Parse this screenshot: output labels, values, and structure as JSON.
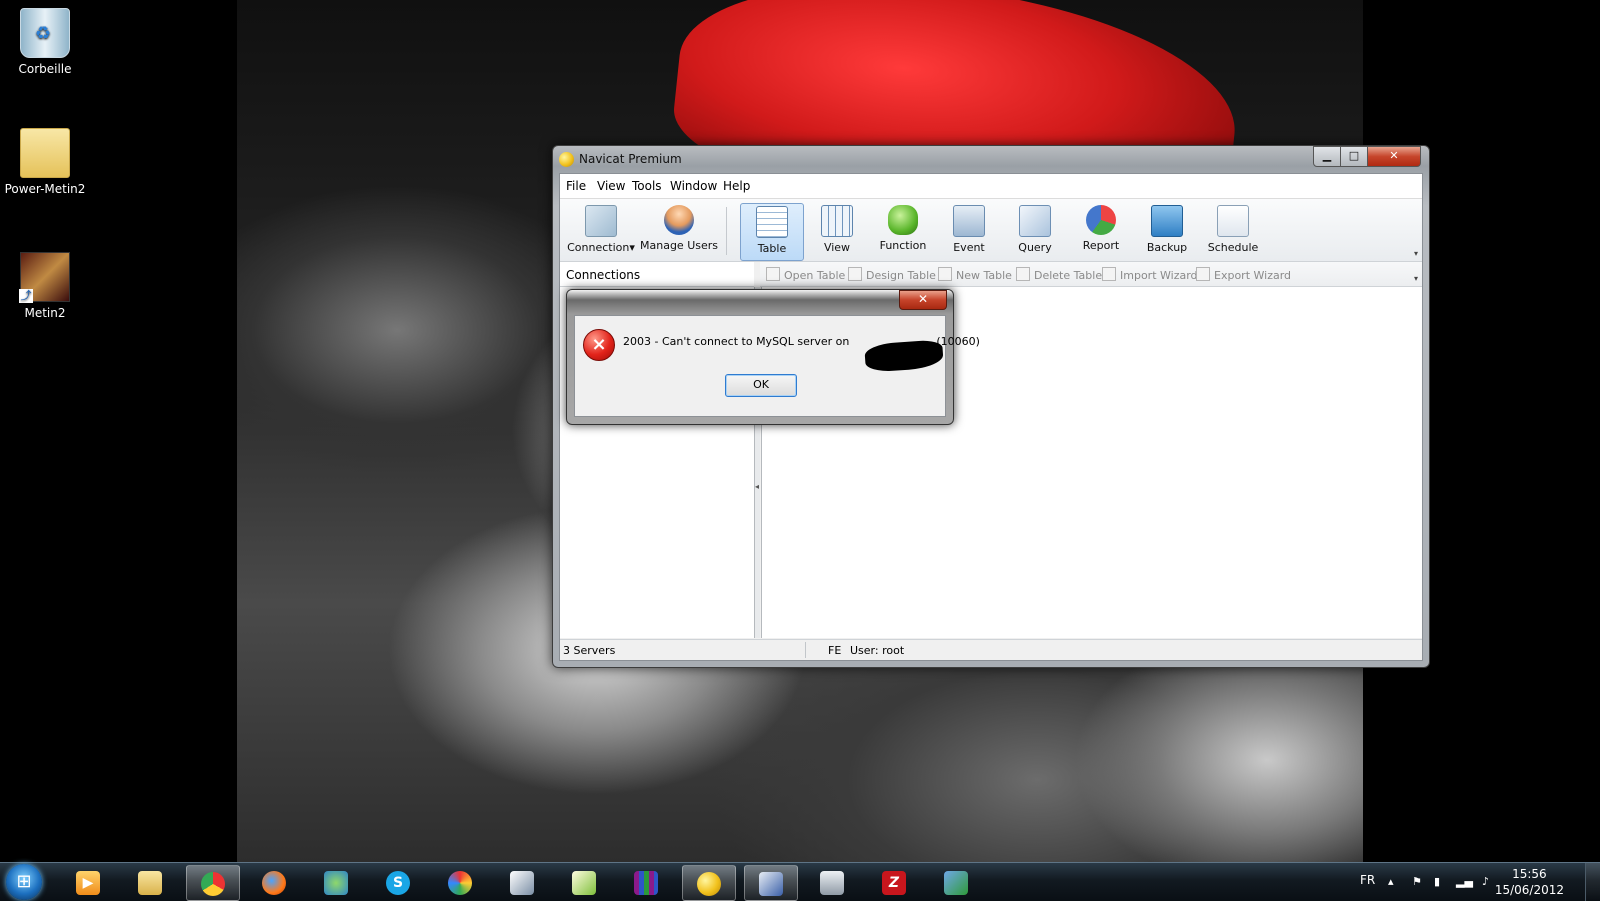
{
  "desktop": {
    "icons": [
      {
        "label": "Corbeille"
      },
      {
        "label": "Power-Metin2"
      },
      {
        "label": "Metin2"
      }
    ]
  },
  "window": {
    "title": "Navicat Premium",
    "controls": {
      "min": "▁",
      "max": "□",
      "close": "✕"
    },
    "menu": [
      "File",
      "View",
      "Tools",
      "Window",
      "Help"
    ],
    "toolbar": [
      {
        "label": "Connection",
        "icon": "connection-icon"
      },
      {
        "label": "Manage Users",
        "icon": "user-icon"
      },
      {
        "label": "Table",
        "icon": "table-icon",
        "active": true
      },
      {
        "label": "View",
        "icon": "view-icon"
      },
      {
        "label": "Function",
        "icon": "function-icon"
      },
      {
        "label": "Event",
        "icon": "event-icon"
      },
      {
        "label": "Query",
        "icon": "query-icon"
      },
      {
        "label": "Report",
        "icon": "report-icon"
      },
      {
        "label": "Backup",
        "icon": "backup-icon"
      },
      {
        "label": "Schedule",
        "icon": "schedule-icon"
      }
    ],
    "connections_header": "Connections",
    "object_actions": [
      "Open Table",
      "Design Table",
      "New Table",
      "Delete Table",
      "Import Wizard",
      "Export Wizard"
    ],
    "status": {
      "servers": "3 Servers",
      "connection": "FE",
      "user": "User: root"
    }
  },
  "dialog": {
    "close": "✕",
    "message_prefix": "2003 - Can't connect to MySQL server on",
    "message_suffix": "(10060)",
    "ok": "OK"
  },
  "taskbar": {
    "apps": [
      "media-player-icon",
      "explorer-icon",
      "chrome-icon",
      "firefox-icon",
      "messenger-icon",
      "skype-icon",
      "paint-icon",
      "editor-icon",
      "notepad-icon",
      "winrar-icon",
      "navicat-icon",
      "network-tool-icon",
      "server-icon",
      "filezilla-icon",
      "vpn-icon"
    ],
    "language": "FR",
    "time": "15:56",
    "date": "15/06/2012"
  },
  "colors": {
    "accent": "#2f7bd0",
    "close_red": "#c6452b",
    "hat_red": "#d11a1a"
  }
}
